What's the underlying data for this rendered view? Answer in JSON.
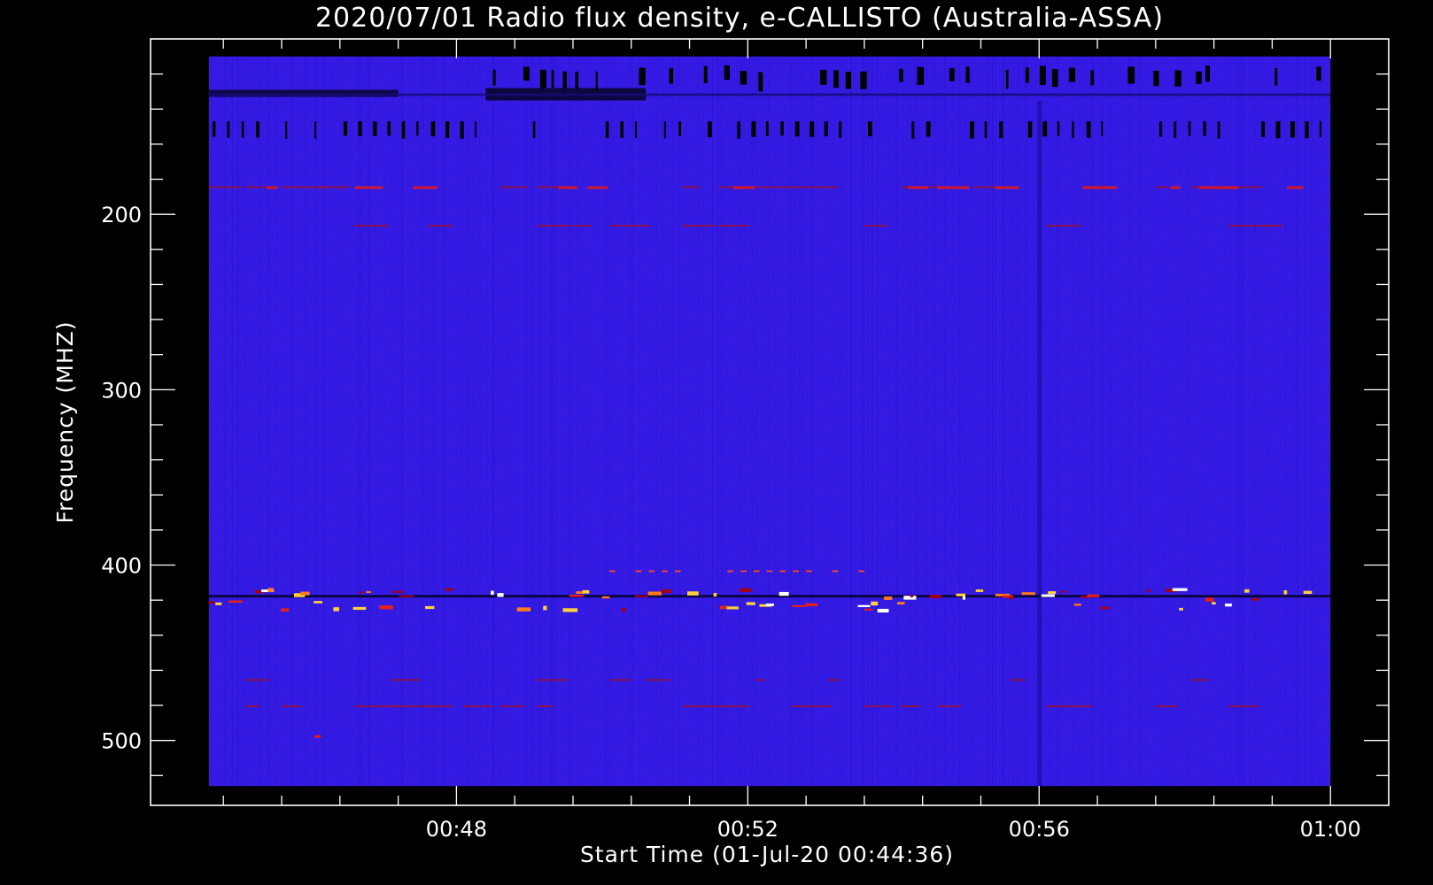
{
  "chart_data": {
    "type": "heatmap",
    "title": "2020/07/01  Radio flux density, e-CALLISTO (Australia-ASSA)",
    "xlabel": "Start Time (01-Jul-20 00:44:36)",
    "ylabel": "Frequency (MHZ)",
    "x_axis": {
      "unit": "time",
      "range": [
        "00:44:36",
        "01:00:00"
      ],
      "major_ticks": [
        "00:48",
        "00:52",
        "00:56",
        "01:00"
      ],
      "tick_minutes": [
        48,
        52,
        56,
        60
      ],
      "minor_tick_step_minutes": 0.8,
      "data_range_minutes": [
        44.6,
        60.0
      ],
      "plot_range_minutes": [
        43.8,
        60.8
      ]
    },
    "y_axis": {
      "unit": "MHz",
      "inverted": true,
      "major_ticks": [
        200,
        300,
        400,
        500
      ],
      "minor_tick_step": 20,
      "data_range": [
        110,
        526
      ],
      "plot_range": [
        100,
        537
      ]
    },
    "colormap": {
      "background": "#2a18e6",
      "dark": "#0b0636",
      "hot": [
        "#a0001a",
        "#e4201a",
        "#ff7a1a",
        "#ffd23a",
        "#ffffff"
      ]
    },
    "features": {
      "persistent_interference_bands_mhz": [
        130,
        135,
        150,
        153,
        184,
        417,
        422,
        465,
        480
      ],
      "strong_emission_band_mhz": [
        412,
        426
      ],
      "dark_vertical_stripe_time": "00:56:00"
    }
  }
}
